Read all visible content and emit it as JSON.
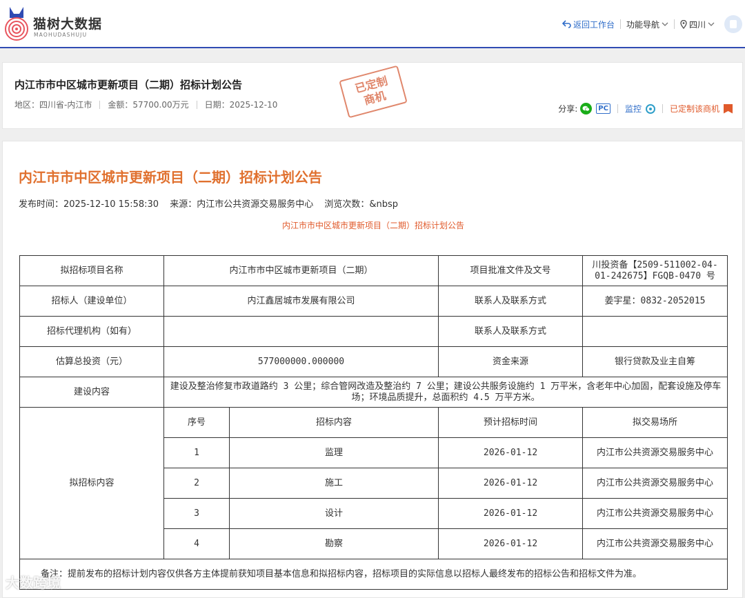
{
  "header": {
    "logo_text": "猫树大数据",
    "logo_sub": "MAOHUDASHUJU",
    "nav": {
      "back_label": "返回工作台",
      "func_label": "功能导航",
      "region_label": "四川"
    }
  },
  "summary": {
    "title": "内江市市中区城市更新项目（二期）招标计划公告",
    "region": "地区：四川省-内江市",
    "amount": "金额：57700.00万元",
    "date": "日期：2025-12-10",
    "stamp_line1": "已定制",
    "stamp_line2": "商机",
    "share_label": "分享:",
    "pc_label": "PC",
    "monitor_label": "监控",
    "custom_label": "已定制该商机"
  },
  "article": {
    "title": "内江市市中区城市更新项目（二期）招标计划公告",
    "publish_time": "发布时间：2025-12-10 15:58:30",
    "source": "来源：内江市公共资源交易服务中心",
    "views": "浏览次数：&nbsp",
    "subtitle": "内江市市中区城市更新项目（二期）招标计划公告"
  },
  "table": {
    "row1": {
      "k1": "拟招标项目名称",
      "v1": "内江市市中区城市更新项目（二期）",
      "k2": "项目批准文件及文号",
      "v2": "川投资备【2509-511002-04-01-242675】FGQB-0470 号"
    },
    "row2": {
      "k1": "招标人（建设单位）",
      "v1": "内江鑫居城市发展有限公司",
      "k2": "联系人及联系方式",
      "v2": "姜宇星：0832-2052015"
    },
    "row3": {
      "k1": "招标代理机构（如有）",
      "v1": "",
      "k2": "联系人及联系方式",
      "v2": ""
    },
    "row4": {
      "k1": "估算总投资（元）",
      "v1": "577000000.000000",
      "k2": "资金来源",
      "v2": "银行贷款及业主自筹"
    },
    "row5": {
      "k1": "建设内容",
      "v1": "建设及整治修复市政道路约 3 公里；综合管网改造及整治约 7 公里；建设公共服务设施约 1 万平米，含老年中心加固，配套设施及停车场；环境品质提升，总面积约 4.5 万平方米。"
    },
    "plan_label": "拟招标内容",
    "plan_headers": [
      "序号",
      "招标内容",
      "预计招标时间",
      "拟交易场所"
    ],
    "plan_rows": [
      {
        "no": "1",
        "content": "监理",
        "time": "2026-01-12",
        "place": "内江市公共资源交易服务中心"
      },
      {
        "no": "2",
        "content": "施工",
        "time": "2026-01-12",
        "place": "内江市公共资源交易服务中心"
      },
      {
        "no": "3",
        "content": "设计",
        "time": "2026-01-12",
        "place": "内江市公共资源交易服务中心"
      },
      {
        "no": "4",
        "content": "勘察",
        "time": "2026-01-12",
        "place": "内江市公共资源交易服务中心"
      }
    ],
    "remark": "备注：提前发布的招标计划内容仅供各方主体提前获知项目基本信息和拟招标内容，招标项目的实际信息以招标人最终发布的招标公告和招标文件为准。"
  },
  "watermark": "大数跨境",
  "colors": {
    "accent_orange": "#e0702e",
    "link_blue": "#2f6dc9",
    "header_border": "#2f4bb3",
    "wechat_green": "#1aad19"
  },
  "icons": [
    "back-arrow-icon",
    "chevron-down-icon",
    "location-pin-icon",
    "avatar-icon",
    "wechat-icon",
    "pc-icon",
    "monitor-icon",
    "bookmark-icon"
  ]
}
